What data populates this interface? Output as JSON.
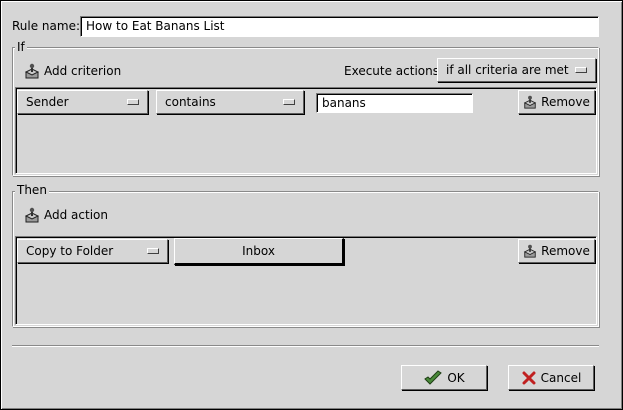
{
  "rule_name": {
    "label": "Rule name:",
    "value": "How to Eat Banans List"
  },
  "if_section": {
    "title": "If",
    "add_criterion_label": "Add criterion",
    "execute_label": "Execute actions",
    "execute_value": "if all criteria are met",
    "criteria": [
      {
        "field": "Sender",
        "operator": "contains",
        "value": "banans",
        "remove_label": "Remove"
      }
    ]
  },
  "then_section": {
    "title": "Then",
    "add_action_label": "Add action",
    "actions": [
      {
        "type": "Copy to Folder",
        "folder": "Inbox",
        "remove_label": "Remove"
      }
    ]
  },
  "footer": {
    "ok_label": "OK",
    "cancel_label": "Cancel"
  },
  "icons": {
    "add": "joystick-icon",
    "remove": "joystick-icon",
    "ok": "check-icon",
    "cancel": "x-icon"
  },
  "colors": {
    "ok_icon": "#4a8a3a",
    "cancel_icon": "#c02020"
  }
}
